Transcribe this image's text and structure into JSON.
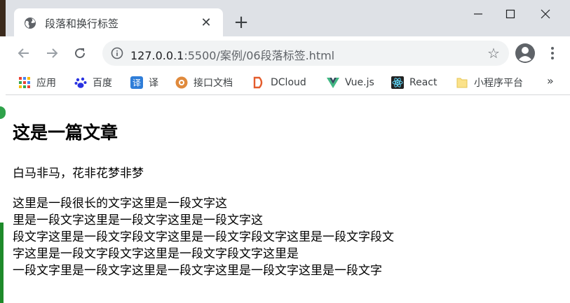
{
  "tab": {
    "title": "段落和换行标签",
    "close_icon": "close-icon",
    "favicon": "globe-icon"
  },
  "window": {
    "new_tab": "+",
    "minimize": "minimize-icon",
    "maximize": "maximize-icon",
    "close": "close-icon"
  },
  "toolbar": {
    "url_host": "127.0.0.1",
    "url_path": ":5500/案例/06段落标签.html",
    "back": "back-arrow-icon",
    "forward": "forward-arrow-icon",
    "reload": "reload-icon"
  },
  "bookmarks": {
    "items": [
      {
        "label": "应用",
        "icon": "apps-grid-icon"
      },
      {
        "label": "百度",
        "icon": "baidu-paw-icon"
      },
      {
        "label": "译",
        "icon": "translate-icon"
      },
      {
        "label": "接口文档",
        "icon": "doc-circle-icon"
      },
      {
        "label": "DCloud",
        "icon": "dcloud-icon"
      },
      {
        "label": "Vue.js",
        "icon": "vue-icon"
      },
      {
        "label": "React",
        "icon": "react-icon"
      },
      {
        "label": "小程序平台",
        "icon": "folder-icon"
      }
    ],
    "more": "»"
  },
  "page": {
    "heading": "这是一篇文章",
    "paragraph1": "白马非马，花非花梦非梦",
    "paragraph2_lines": [
      "这里是一段很长的文字这里是一段文字这",
      "里是一段文字这里是一段文字这里是一段文字这",
      "段文字这里是一段文字段文字这里是一段文字段文字这里是一段文字段文",
      "字这里是一段文字段文字这里是一段文字段文字这里是",
      "一段文字里是一段文字这里是一段文字这里是一段文字这里是一段文字"
    ]
  },
  "colors": {
    "tabstrip": "#dee1e6",
    "omnibox": "#f1f3f4",
    "text": "#202124"
  }
}
